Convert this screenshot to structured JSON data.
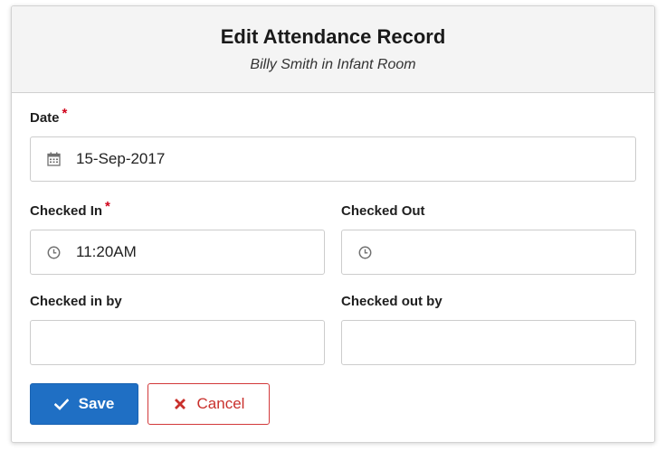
{
  "dialog": {
    "title": "Edit Attendance Record",
    "subtitle": "Billy Smith in Infant Room"
  },
  "fields": {
    "date": {
      "label": "Date",
      "required": true,
      "value": "15-Sep-2017",
      "icon": "calendar-icon"
    },
    "checked_in": {
      "label": "Checked In",
      "required": true,
      "value": "11:20AM",
      "icon": "clock-icon"
    },
    "checked_out": {
      "label": "Checked Out",
      "required": false,
      "value": "",
      "icon": "clock-icon"
    },
    "checked_in_by": {
      "label": "Checked in by",
      "value": ""
    },
    "checked_out_by": {
      "label": "Checked out by",
      "value": ""
    },
    "required_marker": "*"
  },
  "buttons": {
    "save_label": "Save",
    "save_icon": "checkmark-icon",
    "cancel_label": "Cancel",
    "cancel_icon": "x-icon"
  },
  "colors": {
    "primary": "#1f6fc4",
    "danger": "#c9302c",
    "required": "#d0021b",
    "header_bg": "#f4f4f4"
  }
}
